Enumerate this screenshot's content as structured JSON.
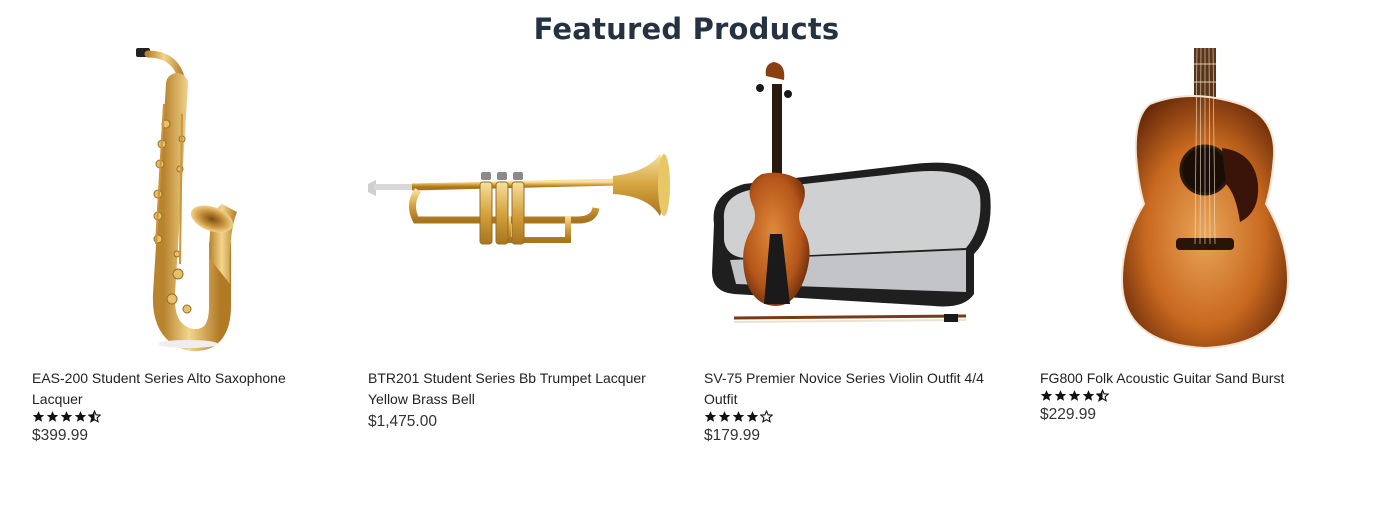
{
  "section": {
    "title": "Featured Products"
  },
  "products": [
    {
      "name": "EAS-200 Student Series Alto Saxophone Lacquer",
      "price": "$399.99",
      "rating": 4.5,
      "image_icon": "saxophone-image"
    },
    {
      "name": "BTR201 Student Series Bb Trumpet Lacquer Yellow Brass Bell",
      "price": "$1,475.00",
      "rating": null,
      "image_icon": "trumpet-image"
    },
    {
      "name": "SV-75 Premier Novice Series Violin Outfit 4/4 Outfit",
      "price": "$179.99",
      "rating": 4,
      "image_icon": "violin-image"
    },
    {
      "name": "FG800 Folk Acoustic Guitar Sand Burst",
      "price": "$229.99",
      "rating": 4.5,
      "image_icon": "guitar-image"
    }
  ],
  "colors": {
    "title": "#253241",
    "brass": "#d9a94a",
    "wood": "#b4571c",
    "case": "#2a2a2a",
    "case_lining": "#cfd0d2"
  }
}
